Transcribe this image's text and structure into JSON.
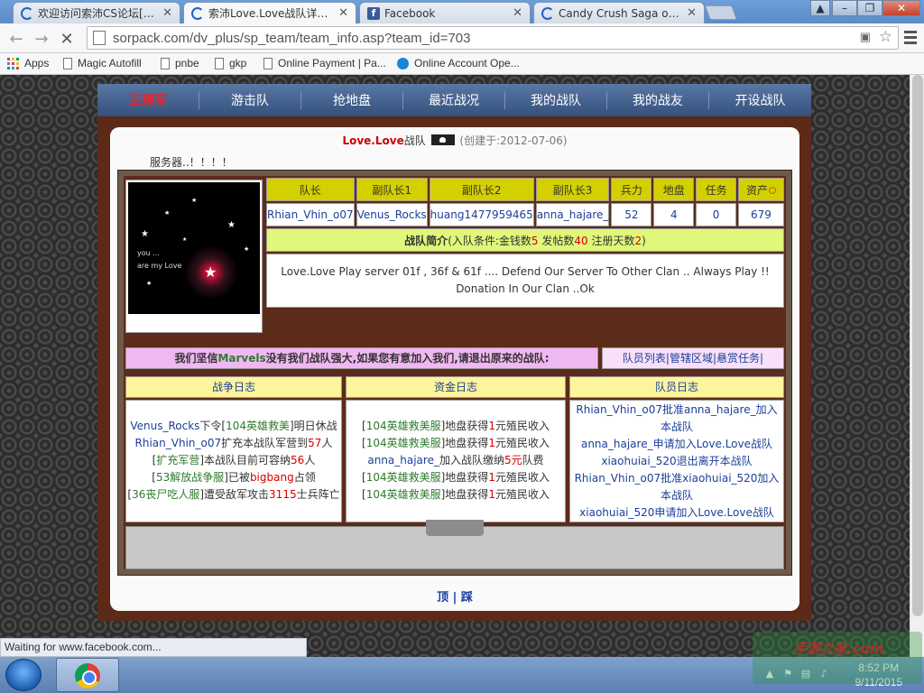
{
  "browser": {
    "tabs": [
      {
        "label": "欢迎访问索沛CS论坛[索沛",
        "icon": "loading-spinner-icon"
      },
      {
        "label": "索沛Love.Love战队详细资",
        "icon": "loading-spinner-icon",
        "active": true
      },
      {
        "label": "Facebook",
        "icon": "facebook-icon"
      },
      {
        "label": "Candy Crush Saga on Face",
        "icon": "loading-spinner-icon"
      }
    ],
    "url": "sorpack.com/dv_plus/sp_team/team_info.asp?team_id=703",
    "bookmarks": [
      {
        "label": "Apps"
      },
      {
        "label": "Magic Autofill"
      },
      {
        "label": "pnbe"
      },
      {
        "label": "gkp"
      },
      {
        "label": "Online Payment | Pa..."
      },
      {
        "label": "Online Account Ope..."
      }
    ],
    "status_text": "Waiting for www.facebook.com..."
  },
  "site": {
    "nav": [
      "正规军",
      "游击队",
      "抢地盘",
      "最近战况",
      "我的战队",
      "我的战友",
      "开设战队"
    ],
    "title": {
      "team": "Love.",
      "team2": "Love",
      "suffix": "战队",
      "created": "(创建于:2012-07-06)"
    },
    "server_note": "服务器..！！！！",
    "avatar_text": [
      "you ...",
      "are my Love"
    ],
    "stats_headers": [
      "队长",
      "副队长1",
      "副队长2",
      "副队长3",
      "兵力",
      "地盘",
      "任务",
      "资产"
    ],
    "stats_values": [
      "Rhian_Vhin_o07",
      "Venus_Rocks",
      "huang1477959465",
      "anna_hajare_",
      "52",
      "4",
      "0",
      "679"
    ],
    "intro": {
      "label": "战队简介",
      "cond_open": "(入队条件:金钱数",
      "money": "5",
      "posts_label": " 发帖数",
      "posts": "40",
      "days_label": " 注册天数",
      "days": "2",
      "cond_close": ")"
    },
    "description": "Love.Love Play server 01f , 36f & 61f .... Defend Our Server To Other Clan .. Always Play !! Donation In Our Clan ..Ok",
    "motto": {
      "pre": "我们坚信",
      "highlight": "Marvels",
      "post": "没有我们战队强大,如果您有意加入我们,请退出原来的战队:"
    },
    "motto_links": [
      "队员列表",
      "管辖区域",
      "悬赏任务"
    ],
    "logs": {
      "war_title": "战争日志",
      "fund_title": "资金日志",
      "member_title": "队员日志",
      "war": [
        [
          "Venus_Rocks",
          "下令[",
          "104英雄救美",
          "]明日休战"
        ],
        [
          "Rhian_Vhin_o07",
          "扩充本战队军营到",
          "57",
          "人"
        ],
        [
          "[",
          "扩充军营",
          "]本战队目前可容纳",
          "56",
          "人"
        ],
        [
          "[",
          "53解放战争服",
          "]已被",
          "bigbang",
          "占领"
        ],
        [
          "[",
          "36丧尸吃人服",
          "]遭受敌军攻击",
          "3115",
          "士兵阵亡"
        ]
      ],
      "fund": [
        [
          "[",
          "104英雄救美服",
          "]地盘获得",
          "1",
          "元殖民收入"
        ],
        [
          "[",
          "104英雄救美服",
          "]地盘获得",
          "1",
          "元殖民收入"
        ],
        [
          "anna_hajare_",
          "加入战队缴纳",
          "5元",
          "队费"
        ],
        [
          "[",
          "104英雄救美服",
          "]地盘获得",
          "1",
          "元殖民收入"
        ],
        [
          "[",
          "104英雄救美服",
          "]地盘获得",
          "1",
          "元殖民收入"
        ]
      ],
      "member": [
        "Rhian_Vhin_o07批准anna_hajare_加入本战队",
        "anna_hajare_申请加入Love.Love战队",
        "xiaohuiai_520退出离开本战队",
        "Rhian_Vhin_o07批准xiaohuiai_520加入本战队",
        "xiaohuiai_520申请加入Love.Love战队"
      ]
    },
    "footer": [
      "顶",
      "|",
      "踩"
    ]
  },
  "taskbar": {
    "time": "8:52 PM",
    "date": "9/11/2015",
    "watermark": "手游之家.com"
  }
}
